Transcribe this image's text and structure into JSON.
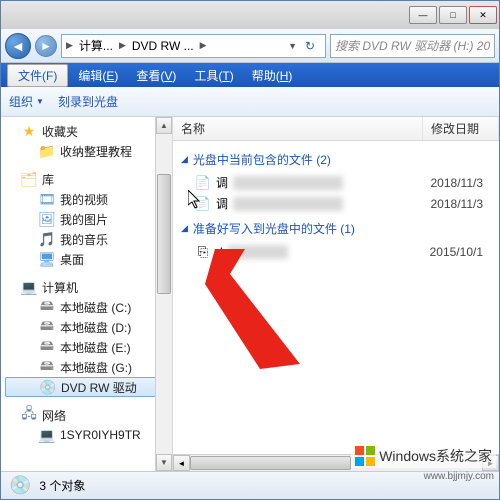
{
  "titlebar": {
    "min": "—",
    "max": "□",
    "close": "✕"
  },
  "nav": {
    "back": "◄",
    "fwd": "►",
    "breadcrumb": {
      "seg1": "计算...",
      "seg2": "DVD RW ...",
      "refresh": "↻"
    },
    "search_placeholder": "搜索 DVD RW 驱动器 (H:) 20"
  },
  "menu": {
    "file": "文件(F)",
    "edit_pre": "编辑(",
    "edit_u": "E",
    "edit_post": ")",
    "view_pre": "查看(",
    "view_u": "V",
    "view_post": ")",
    "tools_pre": "工具(",
    "tools_u": "T",
    "tools_post": ")",
    "help_pre": "帮助(",
    "help_u": "H",
    "help_post": ")"
  },
  "toolbar": {
    "organize": "组织",
    "burn": "刻录到光盘",
    "drop": "▼"
  },
  "sidebar": {
    "items": [
      {
        "label": "收藏夹"
      },
      {
        "label": "收纳整理教程"
      },
      {
        "label": "库"
      },
      {
        "label": "我的视频"
      },
      {
        "label": "我的图片"
      },
      {
        "label": "我的音乐"
      },
      {
        "label": "桌面"
      },
      {
        "label": "计算机"
      },
      {
        "label": "本地磁盘 (C:)"
      },
      {
        "label": "本地磁盘 (D:)"
      },
      {
        "label": "本地磁盘 (E:)"
      },
      {
        "label": "本地磁盘 (G:)"
      },
      {
        "label": "DVD RW 驱动"
      },
      {
        "label": "网络"
      },
      {
        "label": "1SYR0IYH9TR"
      }
    ]
  },
  "columns": {
    "name": "名称",
    "date": "修改日期"
  },
  "groups": [
    {
      "header": "光盘中当前包含的文件 (2)",
      "files": [
        {
          "name": "调",
          "date": "2018/11/3"
        },
        {
          "name": "调",
          "date": "2018/11/3"
        }
      ]
    },
    {
      "header": "准备好写入到光盘中的文件 (1)",
      "files": [
        {
          "name": "d",
          "date": "2015/10/1"
        }
      ]
    }
  ],
  "status": {
    "text": "3 个对象"
  },
  "watermark": {
    "text": "Windows系统之家",
    "url": "www.bjjmjy.com"
  }
}
